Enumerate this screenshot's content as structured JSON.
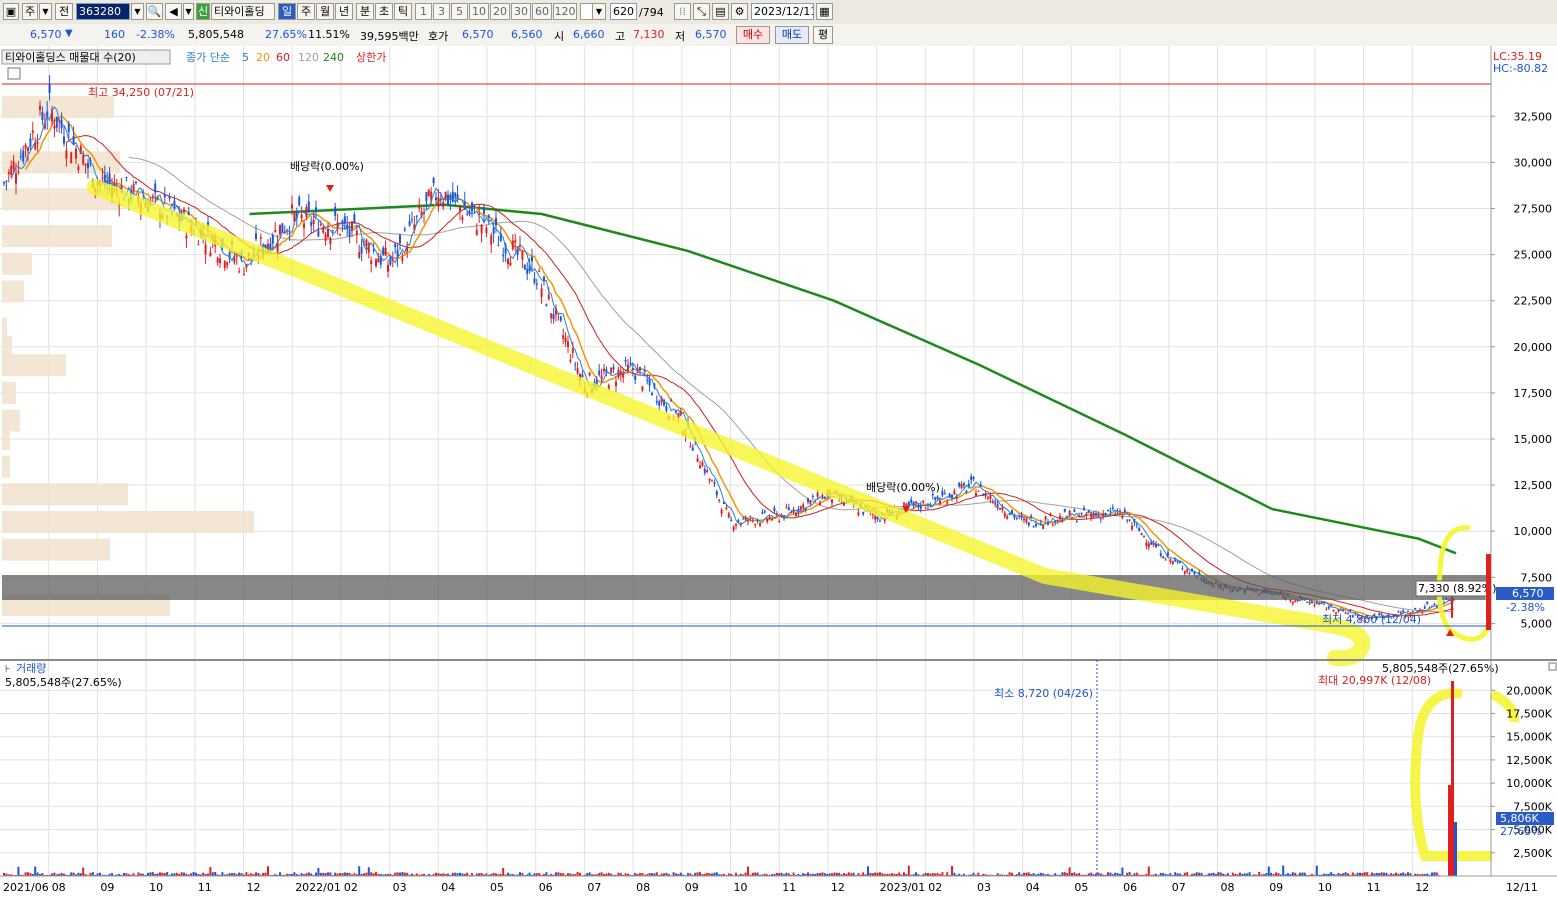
{
  "toolbar": {
    "market": "주",
    "period_select": "전",
    "code": "363280",
    "badge": "신",
    "name": "티와이홀딩",
    "periods": [
      "일",
      "주",
      "월",
      "년",
      "분",
      "초",
      "틱"
    ],
    "active_period": "일",
    "ticks": [
      "1",
      "3",
      "5",
      "10",
      "20",
      "30",
      "60",
      "120"
    ],
    "count": "620",
    "total": "/794",
    "date": "2023/12/11"
  },
  "quote": {
    "price": "6,570",
    "arrow": "▼",
    "change": "160",
    "change_pct": "-2.38%",
    "volume": "5,805,548",
    "vol_ratio": "27.65%",
    "turnover": "11.51%",
    "amount": "39,595백만",
    "bid_label": "호가",
    "ask": "6,570",
    "bid": "6,560",
    "open_label": "시",
    "open": "6,660",
    "high_label": "고",
    "high": "7,130",
    "low_label": "저",
    "low": "6,570",
    "buy_label": "매수",
    "sell_label": "매도",
    "eval_label": "평"
  },
  "legend": {
    "title": "티와이홀딩스 매물대 수(20)",
    "ma_prefix": "종가 단순",
    "ma5": "5",
    "ma20": "20",
    "ma60": "60",
    "ma120": "120",
    "ma240": "240",
    "limit": "상한가",
    "lc": "LC:35.19",
    "hc": "HC:-80.82",
    "volume_title": "거래량",
    "volume_value": "5,805,548주(27.65%)"
  },
  "annotations": {
    "max_price": "최고 34,250 (07/21)",
    "min_price": "최저 4,860 (12/04)",
    "dividend1": "배당락(0.00%)",
    "dividend2": "배당락(0.00%)",
    "last_high": "7,330 (8.92%)",
    "vol_min": "최소 8,720 (04/26)",
    "vol_max": "최대 20,997K (12/08)",
    "vol_top": "5,805,548주(27.65%)"
  },
  "price_tags": {
    "current": "6,570",
    "change": "-2.38%",
    "volume_current": "5,806K",
    "volume_pct": "27.65%"
  },
  "colors": {
    "up": "#e02020",
    "down": "#1c55d8",
    "ma5": "#2a7fd0",
    "ma20": "#f0960a",
    "ma60": "#cc2020",
    "ma120": "#a0a0a0",
    "ma240": "#1e8a1e",
    "highlight": "#f5f52a"
  },
  "chart_data": [
    {
      "type": "line",
      "title": "티와이홀딩스 매물대 수(20)",
      "y_ticks": [
        "32,500",
        "30,000",
        "27,500",
        "25,000",
        "22,500",
        "20,000",
        "17,500",
        "15,000",
        "12,500",
        "10,000",
        "7,500",
        "5,000"
      ],
      "ylim": [
        2000,
        35500
      ],
      "x_ticks": [
        "2021/06",
        "08",
        "09",
        "10",
        "11",
        "12",
        "2022/01",
        "02",
        "03",
        "04",
        "05",
        "06",
        "07",
        "08",
        "09",
        "10",
        "11",
        "12",
        "2023/01",
        "02",
        "03",
        "04",
        "05",
        "06",
        "07",
        "08",
        "09",
        "10",
        "11",
        "12",
        "12/11"
      ],
      "series": [
        {
          "name": "종가",
          "x": [
            "2021/06",
            "2021/07",
            "2021/08",
            "2021/09",
            "2021/10",
            "2021/11",
            "2021/12",
            "2022/01",
            "2022/02",
            "2022/03",
            "2022/04",
            "2022/05",
            "2022/06",
            "2022/07",
            "2022/08",
            "2022/09",
            "2022/10",
            "2022/11",
            "2022/12",
            "2023/01",
            "2023/02",
            "2023/03",
            "2023/04",
            "2023/05",
            "2023/06",
            "2023/07",
            "2023/08",
            "2023/09",
            "2023/10",
            "2023/11",
            "2023/12"
          ],
          "values": [
            28500,
            33000,
            29000,
            28000,
            26500,
            24500,
            27000,
            26500,
            24500,
            28500,
            26500,
            24000,
            18000,
            18800,
            16000,
            10500,
            10800,
            12000,
            10800,
            11500,
            12500,
            10500,
            10800,
            11000,
            8500,
            7000,
            6700,
            6100,
            5300,
            5600,
            6570
          ]
        },
        {
          "name": "240",
          "x": [
            "2021/11",
            "2022/03",
            "2022/05",
            "2022/08",
            "2022/11",
            "2023/02",
            "2023/05",
            "2023/08",
            "2023/11",
            "2023/12"
          ],
          "values": [
            27200,
            27700,
            27200,
            25200,
            22500,
            19000,
            15200,
            11200,
            9600,
            8800
          ]
        }
      ]
    },
    {
      "type": "bar",
      "title": "거래량",
      "y_ticks": [
        "20,000K",
        "17,500K",
        "15,000K",
        "12,500K",
        "10,000K",
        "7,500K",
        "5,000K",
        "2,500K"
      ],
      "ylim": [
        0,
        21000
      ],
      "x": [
        "2023/12/07",
        "2023/12/08",
        "2023/12/11"
      ],
      "values": [
        9800,
        20997,
        5806
      ]
    }
  ]
}
